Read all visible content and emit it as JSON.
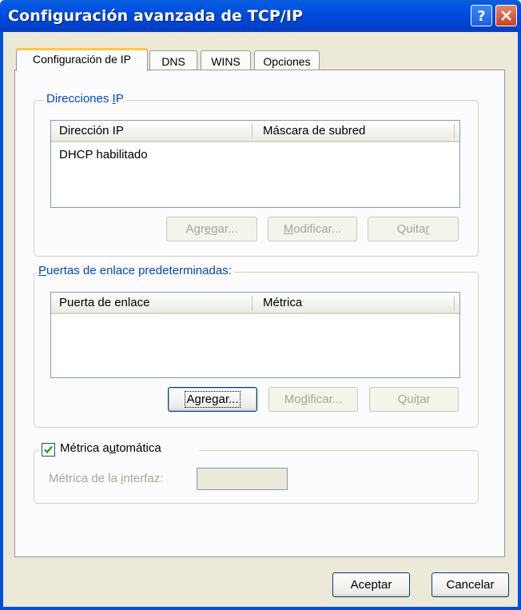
{
  "window": {
    "title": "Configuración avanzada de TCP/IP"
  },
  "tabs": [
    {
      "label": "Configuración de IP"
    },
    {
      "label": "DNS"
    },
    {
      "label": "WINS"
    },
    {
      "label": "Opciones"
    }
  ],
  "ip_group": {
    "legend_pre": "Direcciones ",
    "legend_u": "I",
    "legend_post": "P",
    "columns": [
      "Dirección IP",
      "Máscara de subred"
    ],
    "rows": [
      "DHCP habilitado"
    ],
    "buttons": {
      "add": {
        "pre": "Agr",
        "u": "e",
        "post": "gar..."
      },
      "edit": {
        "pre": "",
        "u": "M",
        "post": "odificar..."
      },
      "remove": {
        "pre": "Quita",
        "u": "r",
        "post": ""
      }
    }
  },
  "gateway_group": {
    "legend_pre": "",
    "legend_u": "P",
    "legend_post": "uertas de enlace predeterminadas:",
    "columns": [
      "Puerta de enlace",
      "Métrica"
    ],
    "buttons": {
      "add": {
        "pre": "Agre",
        "u": "g",
        "post": "ar..."
      },
      "edit": {
        "pre": "Mo",
        "u": "d",
        "post": "ificar..."
      },
      "remove": {
        "pre": "Qui",
        "u": "t",
        "post": "ar"
      }
    }
  },
  "metric": {
    "auto_pre": "Métrica a",
    "auto_u": "u",
    "auto_post": "tomática",
    "auto_checked": true,
    "interface_pre": "Métrica de la ",
    "interface_u": "i",
    "interface_post": "nterfaz:",
    "interface_value": ""
  },
  "footer": {
    "ok": "Aceptar",
    "cancel": "Cancelar"
  }
}
